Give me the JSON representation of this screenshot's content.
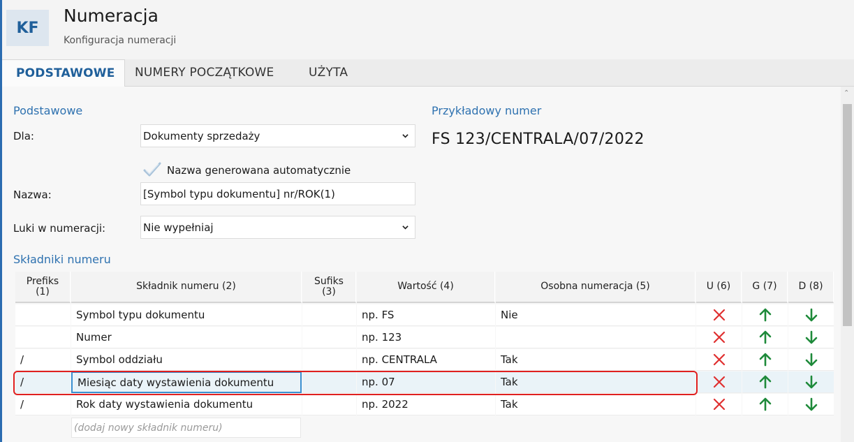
{
  "app": {
    "logo": "KF",
    "title": "Numeracja",
    "subtitle": "Konfiguracja numeracji"
  },
  "tabs": [
    {
      "label": "PODSTAWOWE",
      "active": true
    },
    {
      "label": "NUMERY POCZĄTKOWE",
      "active": false
    },
    {
      "label": "UŻYTA",
      "active": false
    }
  ],
  "basic": {
    "section_label": "Podstawowe",
    "dla_label": "Dla:",
    "dla_value": "Dokumenty sprzedaży",
    "auto_name_label": "Nazwa generowana automatycznie",
    "auto_name_checked": true,
    "nazwa_label": "Nazwa:",
    "nazwa_value": "[Symbol typu dokumentu] nr/ROK(1)",
    "luki_label": "Luki w numeracji:",
    "luki_value": "Nie wypełniaj"
  },
  "example": {
    "label": "Przykładowy numer",
    "value": "FS 123/CENTRALA/07/2022"
  },
  "components": {
    "section_label": "Składniki numeru",
    "columns": {
      "prefiks": "Prefiks\n(1)",
      "skladnik": "Składnik numeru (2)",
      "sufiks": "Sufiks\n(3)",
      "wartosc": "Wartość (4)",
      "osobna": "Osobna numeracja (5)",
      "u": "U (6)",
      "g": "G (7)",
      "d": "D (8)"
    },
    "rows": [
      {
        "prefiks": "",
        "skladnik": "Symbol typu dokumentu",
        "sufiks": "",
        "wartosc": "np. FS",
        "osobna": "Nie"
      },
      {
        "prefiks": "",
        "skladnik": "Numer",
        "sufiks": "",
        "wartosc": "np. 123",
        "osobna": ""
      },
      {
        "prefiks": "/",
        "skladnik": "Symbol oddziału",
        "sufiks": "",
        "wartosc": "np. CENTRALA",
        "osobna": "Tak"
      },
      {
        "prefiks": "/",
        "skladnik": "Miesiąc daty wystawienia dokumentu",
        "sufiks": "",
        "wartosc": "np. 07",
        "osobna": "Tak"
      },
      {
        "prefiks": "/",
        "skladnik": "Rok daty wystawienia dokumentu",
        "sufiks": "",
        "wartosc": "np. 2022",
        "osobna": "Tak"
      }
    ],
    "add_placeholder": "(dodaj nowy składnik numeru)"
  },
  "colors": {
    "accent": "#1f5f9a",
    "delete": "#e03030",
    "arrows": "#1e8a3a",
    "highlight": "#e02020"
  },
  "icons": {
    "delete": "close-icon",
    "up": "arrow-up-icon",
    "down": "arrow-down-icon",
    "dropdown": "chevron-down-icon",
    "check": "checkmark-icon"
  }
}
